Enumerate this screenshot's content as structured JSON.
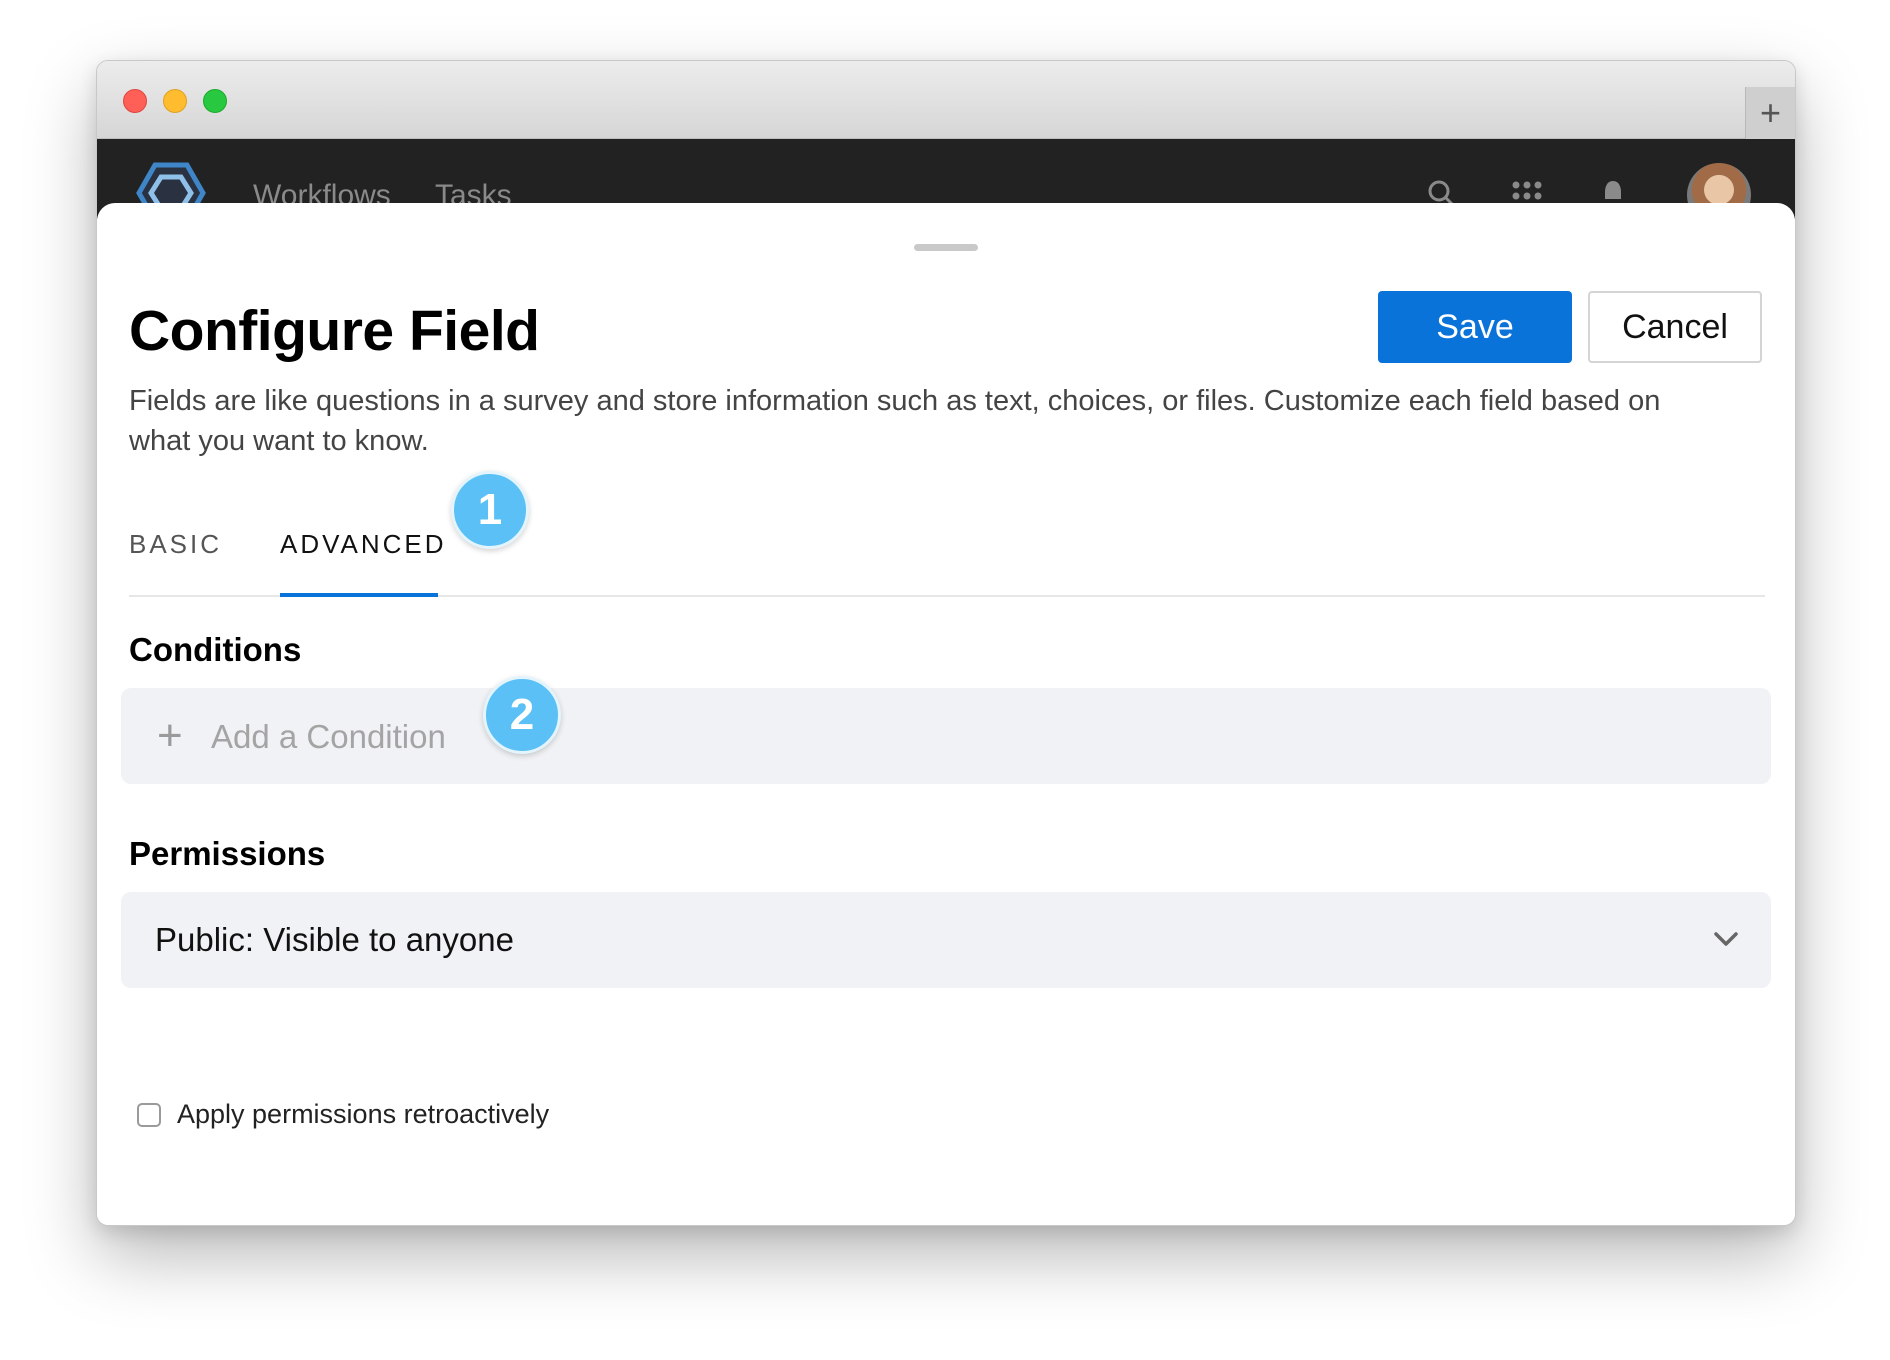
{
  "browser": {
    "new_tab_label": "+"
  },
  "app_nav": {
    "items": [
      {
        "label": "Workflows"
      },
      {
        "label": "Tasks"
      }
    ],
    "icons": [
      "logo-icon",
      "search-icon",
      "apps-grid-icon",
      "notifications-bell-icon",
      "user-avatar"
    ]
  },
  "modal": {
    "title": "Configure Field",
    "save_label": "Save",
    "cancel_label": "Cancel",
    "description": "Fields are like questions in a survey and store information such as text, choices, or files. Customize each field based on what you want to know.",
    "tabs": [
      {
        "label": "BASIC",
        "active": false
      },
      {
        "label": "ADVANCED",
        "active": true
      }
    ],
    "callouts": [
      "1",
      "2"
    ],
    "conditions": {
      "heading": "Conditions",
      "add_label": "Add a Condition"
    },
    "permissions": {
      "heading": "Permissions",
      "selected": "Public: Visible to anyone",
      "retroactive_label": "Apply permissions retroactively",
      "retroactive_checked": false
    }
  },
  "colors": {
    "primary": "#0a73d9",
    "callout": "#5bc0f5",
    "appbar": "#222222",
    "field_bg": "#f1f2f5"
  }
}
